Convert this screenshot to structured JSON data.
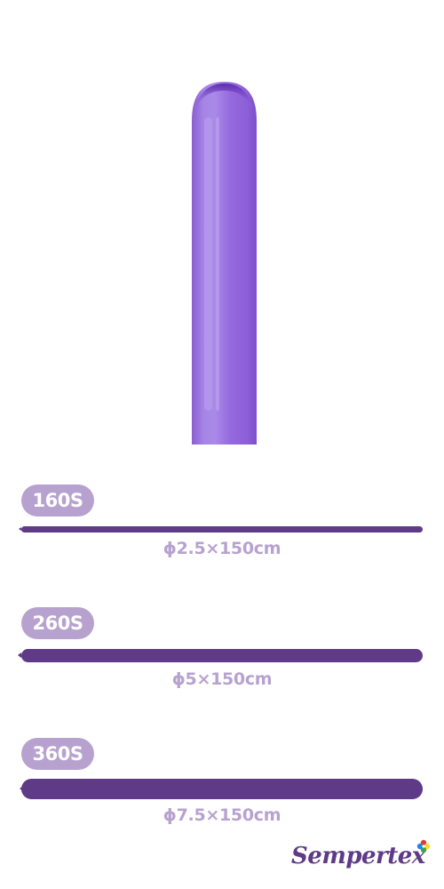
{
  "product": {
    "color_name": "purple",
    "balloon_color": "#9a6fdc",
    "accent_color": "#5f3a87",
    "badge_color": "#b7a2cf"
  },
  "sizes": [
    {
      "label": "160S",
      "dimensions": "ϕ2.5×150cm"
    },
    {
      "label": "260S",
      "dimensions": "ϕ5×150cm"
    },
    {
      "label": "360S",
      "dimensions": "ϕ7.5×150cm"
    }
  ],
  "brand": {
    "name": "Sempertex",
    "logo_icon": "sempertex-flower-icon"
  }
}
